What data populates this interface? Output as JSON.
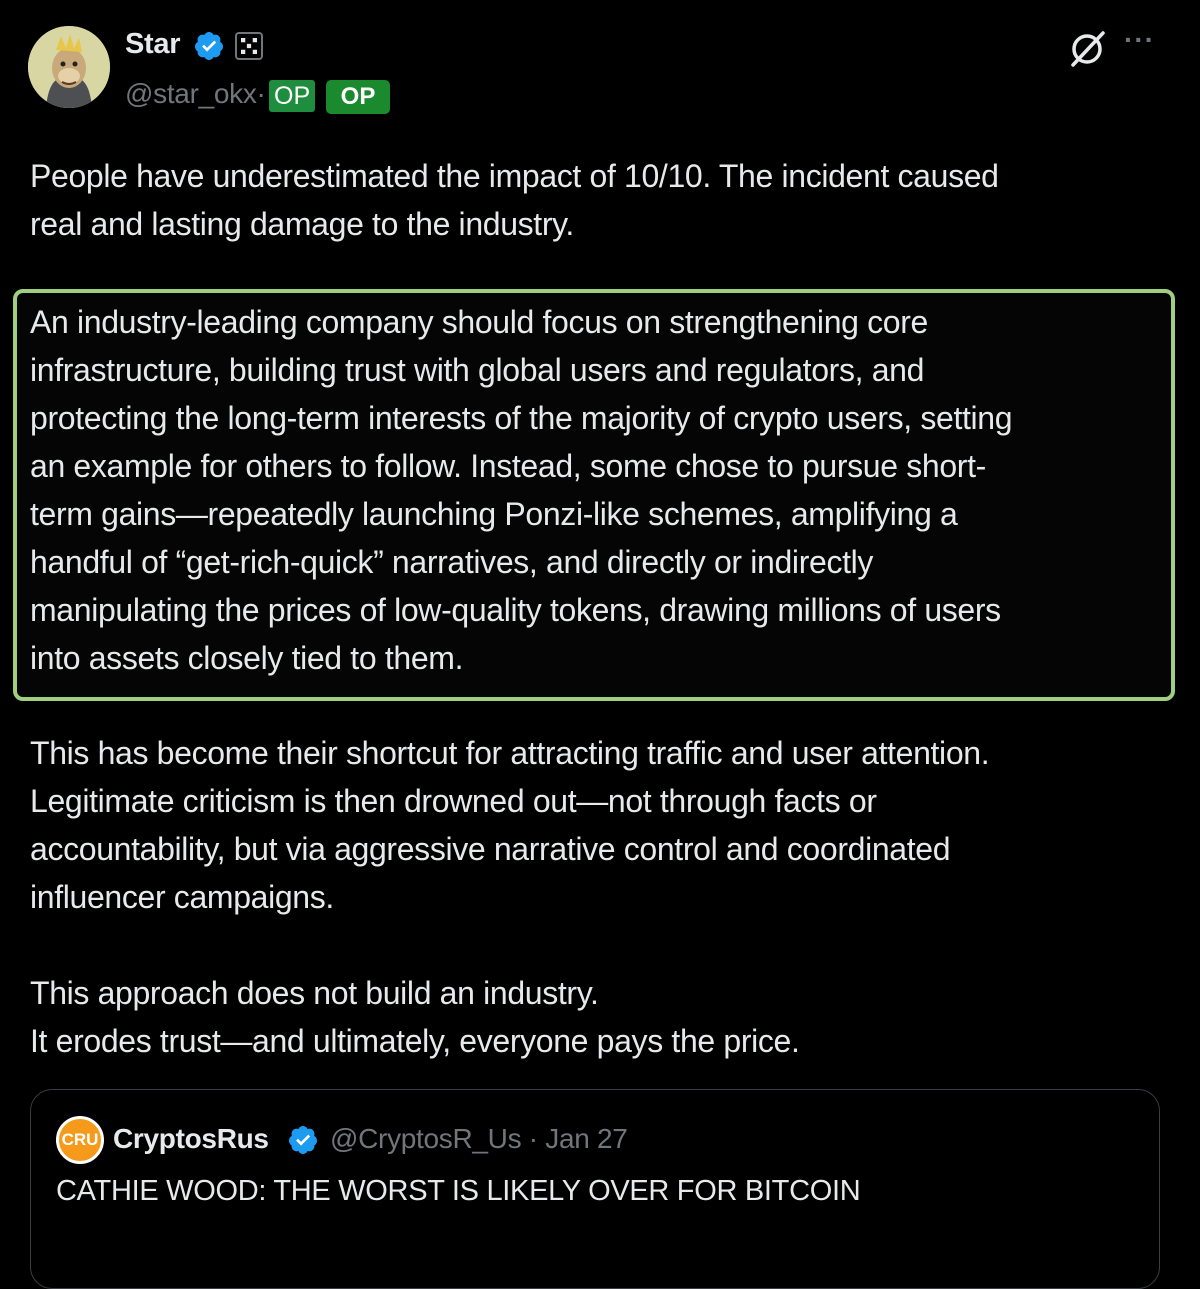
{
  "author": {
    "name": "Star",
    "handle": "@star_okx·",
    "badges": [
      "OP",
      "OP"
    ],
    "avatar_icon": "bored-ape-avatar",
    "verified_icon": "verified-badge-icon",
    "affiliation_icon": "okx-logo-icon"
  },
  "header_icons": [
    "grok-icon",
    "more-icon"
  ],
  "more_glyph": "···",
  "post": {
    "p1": "People have underestimated the impact of 10/10. The incident caused\nreal and lasting damage to the industry.",
    "p2": "An industry-leading company should focus on strengthening core\ninfrastructure, building trust with global users and regulators, and\nprotecting the long-term interests of the majority of crypto users, setting\nan example for others to follow. Instead, some chose to pursue short-\nterm gains—repeatedly launching Ponzi-like schemes, amplifying a\nhandful of “get-rich-quick” narratives, and directly or indirectly\nmanipulating the prices of low-quality tokens, drawing millions of users\ninto assets closely tied to them.",
    "p3": "This has become their shortcut for attracting traffic and user attention.\nLegitimate criticism is then drowned out—not through facts or\naccountability, but via aggressive narrative control and coordinated\ninfluencer campaigns.",
    "p4": "This approach does not build an industry.\nIt erodes trust—and ultimately, everyone pays the price."
  },
  "quoted": {
    "avatar_text": "CRU",
    "name": "CryptosRus",
    "meta": "@CryptosR_Us · Jan 27",
    "text": "CATHIE WOOD: THE WORST IS LIKELY OVER FOR BITCOIN"
  },
  "colors": {
    "background": "#000000",
    "text": "#e7e9ea",
    "muted": "#71767b",
    "verified": "#1d9bf0",
    "highlight_border": "#9fcf7f",
    "badge_green": "#1b8a2e"
  }
}
